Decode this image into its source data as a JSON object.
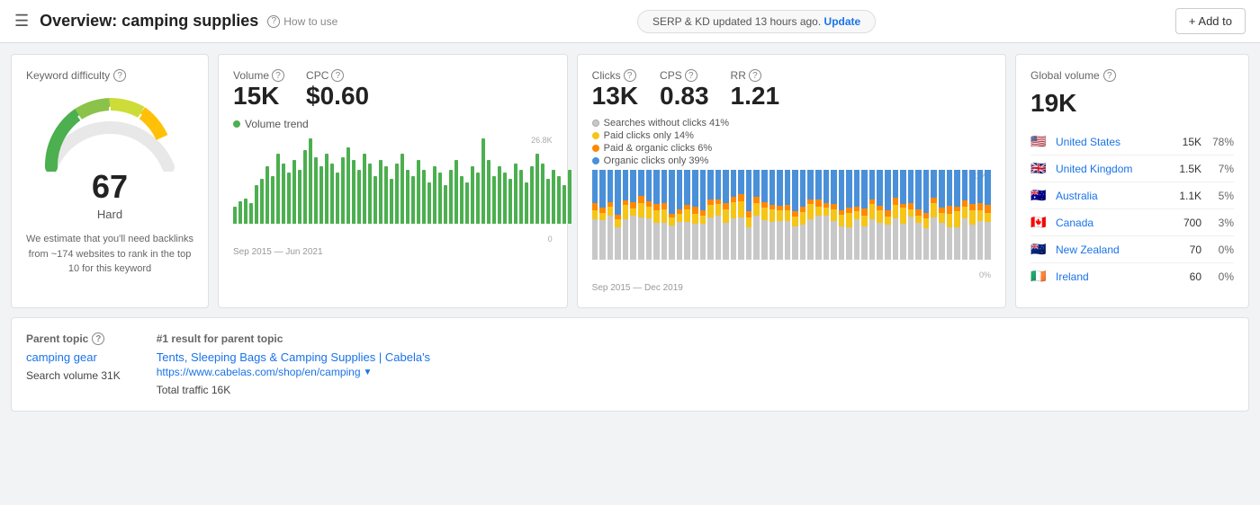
{
  "header": {
    "menu_icon": "☰",
    "title": "Overview: camping supplies",
    "help_label": "How to use",
    "serp_notice": "SERP & KD updated 13 hours ago.",
    "update_label": "Update",
    "add_to_label": "+ Add to"
  },
  "kd_card": {
    "title": "Keyword difficulty",
    "score": "67",
    "label": "Hard",
    "description": "We estimate that you'll need backlinks from ~174 websites to rank in the top 10 for this keyword"
  },
  "volume_card": {
    "volume_label": "Volume",
    "cpc_label": "CPC",
    "volume_value": "15K",
    "cpc_value": "$0.60",
    "trend_label": "Volume trend",
    "date_range": "Sep 2015 — Jun 2021",
    "chart_max": "26.8K",
    "chart_min": "0"
  },
  "clicks_card": {
    "clicks_label": "Clicks",
    "cps_label": "CPS",
    "rr_label": "RR",
    "clicks_value": "13K",
    "cps_value": "0.83",
    "rr_value": "1.21",
    "legend": [
      {
        "color": "#c8c8c8",
        "label": "Searches without clicks 41%"
      },
      {
        "color": "#f5c518",
        "label": "Paid clicks only 14%"
      },
      {
        "color": "#ff8800",
        "label": "Paid & organic clicks 6%"
      },
      {
        "color": "#4a90d9",
        "label": "Organic clicks only 39%"
      }
    ],
    "date_range": "Sep 2015 — Dec 2019",
    "chart_max": "100%",
    "chart_min": "0%"
  },
  "global_card": {
    "title": "Global volume",
    "value": "19K",
    "countries": [
      {
        "flag": "🇺🇸",
        "name": "United States",
        "vol": "15K",
        "pct": "78%"
      },
      {
        "flag": "🇬🇧",
        "name": "United Kingdom",
        "vol": "1.5K",
        "pct": "7%"
      },
      {
        "flag": "🇦🇺",
        "name": "Australia",
        "vol": "1.1K",
        "pct": "5%"
      },
      {
        "flag": "🇨🇦",
        "name": "Canada",
        "vol": "700",
        "pct": "3%"
      },
      {
        "flag": "🇳🇿",
        "name": "New Zealand",
        "vol": "70",
        "pct": "0%"
      },
      {
        "flag": "🇮🇪",
        "name": "Ireland",
        "vol": "60",
        "pct": "0%"
      }
    ]
  },
  "bottom_card": {
    "parent_topic_title": "Parent topic",
    "parent_topic_link": "camping gear",
    "search_volume_label": "Search volume 31K",
    "result_title": "#1 result for parent topic",
    "result_link_text": "Tents, Sleeping Bags & Camping Supplies | Cabela's",
    "result_url": "https://www.cabelas.com/shop/en/camping",
    "total_traffic_label": "Total traffic 16K"
  },
  "colors": {
    "accent_blue": "#1a73e8",
    "green": "#4caf50",
    "yellow": "#f5c518",
    "orange": "#ff8800",
    "blue_bar": "#4a90d9",
    "gray_bar": "#c8c8c8"
  }
}
